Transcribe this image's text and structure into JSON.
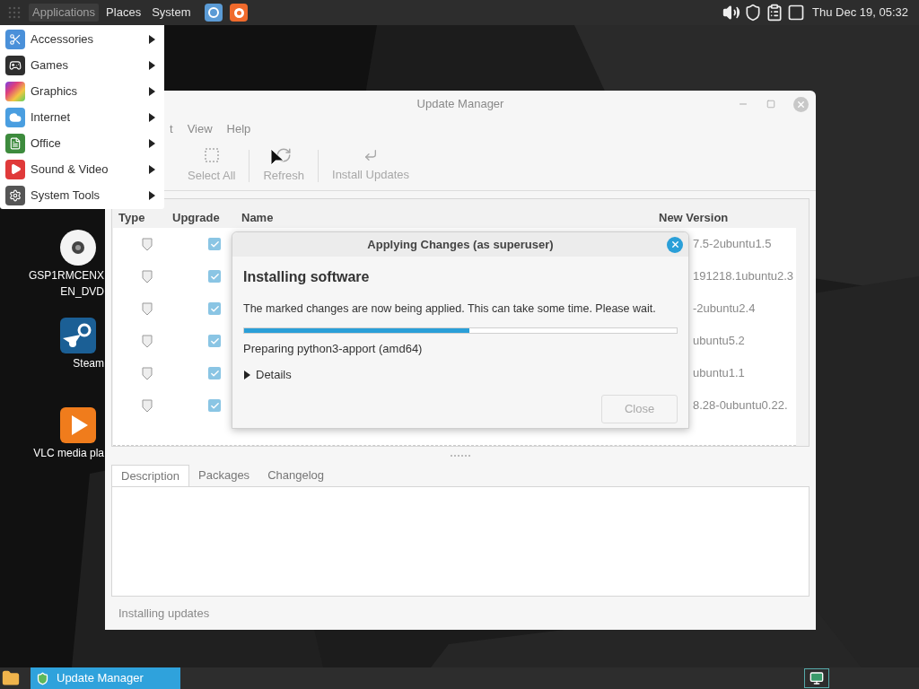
{
  "top_panel": {
    "menus": [
      {
        "label": "Applications",
        "selected": true
      },
      {
        "label": "Places",
        "selected": false
      },
      {
        "label": "System",
        "selected": false
      }
    ],
    "clock": "Thu Dec 19, 05:32"
  },
  "app_menu": {
    "items": [
      {
        "label": "Accessories"
      },
      {
        "label": "Games"
      },
      {
        "label": "Graphics"
      },
      {
        "label": "Internet"
      },
      {
        "label": "Office"
      },
      {
        "label": "Sound & Video"
      },
      {
        "label": "System Tools"
      }
    ]
  },
  "desktop_icons": [
    {
      "lines": [
        "GSP1RMCENX",
        "EN_DVD"
      ]
    },
    {
      "lines": [
        "Steam"
      ]
    },
    {
      "lines": [
        "VLC media pla"
      ]
    }
  ],
  "update_window": {
    "title": "Update Manager",
    "menu": [
      "t",
      "View",
      "Help"
    ],
    "toolbar": [
      {
        "label": "Select All",
        "disabled": true
      },
      {
        "label": "Refresh",
        "disabled": true
      },
      {
        "label": "Install Updates",
        "disabled": true
      }
    ],
    "columns": [
      "Type",
      "Upgrade",
      "Name",
      "New Version"
    ],
    "rows": [
      {
        "checked": true,
        "new_version": "7.5-2ubuntu1.5"
      },
      {
        "checked": true,
        "new_version": "191218.1ubuntu2.3"
      },
      {
        "checked": true,
        "new_version": "-2ubuntu2.4"
      },
      {
        "checked": true,
        "new_version": "ubuntu5.2"
      },
      {
        "checked": true,
        "new_version": "ubuntu1.1"
      },
      {
        "checked": true,
        "new_version": "8.28-0ubuntu0.22."
      }
    ],
    "detail_tabs": [
      {
        "label": "Description",
        "selected": true
      },
      {
        "label": "Packages",
        "selected": false
      },
      {
        "label": "Changelog",
        "selected": false
      }
    ],
    "status": "Installing updates"
  },
  "dialog": {
    "title": "Applying Changes (as superuser)",
    "heading": "Installing software",
    "message": "The marked changes are now being applied. This can take some time. Please wait.",
    "progress": {
      "level": 0.52
    },
    "current_action": "Preparing python3-apport (amd64)",
    "details": {
      "label": "Details",
      "expanded": false
    },
    "close_button": {
      "label": "Close",
      "disabled": true
    }
  },
  "taskbar": {
    "tasks": [
      {
        "label": "Update Manager",
        "selected": true
      }
    ]
  }
}
